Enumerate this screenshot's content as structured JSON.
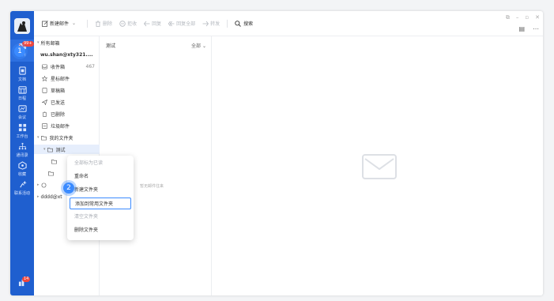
{
  "rail": {
    "mail_badge": "99+",
    "items": [
      {
        "label": "邮件"
      },
      {
        "label": "文档"
      },
      {
        "label": "日程"
      },
      {
        "label": "会议"
      },
      {
        "label": "工作台"
      },
      {
        "label": "通讯录"
      },
      {
        "label": "收藏"
      },
      {
        "label": "联系活动"
      }
    ],
    "bottom_badge": "14"
  },
  "toolbar": {
    "compose": "新建邮件",
    "delete": "删除",
    "reject": "拒收",
    "reply": "回复",
    "reply_all": "回复全部",
    "forward": "转发",
    "search": "搜索"
  },
  "folders": {
    "all_mail": "所有邮箱",
    "account": "wu.shan@xty321....",
    "inbox": {
      "label": "收件箱",
      "count": "467"
    },
    "starred": "星标邮件",
    "drafts": "草稿箱",
    "sent": "已发送",
    "deleted": "已删除",
    "spam": "垃圾邮件",
    "my_folders": "我的文件夹",
    "selected_folder": "测试",
    "second_account": "dddd@xt"
  },
  "list": {
    "title": "测试",
    "filter": "全部",
    "empty_text": "暂无邮件往来"
  },
  "context_menu": {
    "items": [
      {
        "label": "全部标为已读",
        "disabled": true
      },
      {
        "label": "重命名",
        "disabled": false
      },
      {
        "label": "新建文件夹",
        "disabled": false
      },
      {
        "label": "添加到常用文件夹",
        "disabled": false
      },
      {
        "label": "清空文件夹",
        "disabled": true
      },
      {
        "label": "删除文件夹",
        "disabled": false
      }
    ]
  },
  "steps": {
    "one": "1",
    "two": "2"
  },
  "colors": {
    "rail": "#1f5fcf",
    "accent": "#3b8bff",
    "badge": "#f0483e"
  }
}
